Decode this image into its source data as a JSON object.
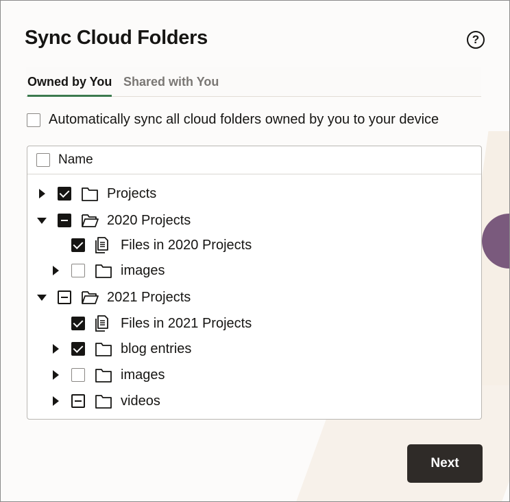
{
  "dialog": {
    "title": "Sync Cloud Folders",
    "help_icon": "question-circle-icon",
    "help_glyph": "?"
  },
  "tabs": [
    {
      "label": "Owned by You",
      "active": true
    },
    {
      "label": "Shared with You",
      "active": false
    }
  ],
  "auto_sync": {
    "label": "Automatically sync all cloud folders owned by you to your device",
    "checked": false
  },
  "tree": {
    "header": {
      "label": "Name",
      "checked": false
    },
    "rows": [
      {
        "label": "Projects",
        "level": 0,
        "expander": "collapsed",
        "state": "checked",
        "icon": "folder-icon"
      },
      {
        "label": "2020 Projects",
        "level": 0,
        "expander": "expanded",
        "state": "mixed-dark",
        "icon": "folder-open-icon"
      },
      {
        "label": "Files in 2020 Projects",
        "level": 1,
        "expander": "none",
        "state": "checked",
        "icon": "document-icon"
      },
      {
        "label": "images",
        "level": 1,
        "expander": "collapsed",
        "state": "unchecked",
        "icon": "folder-icon"
      },
      {
        "label": "2021 Projects",
        "level": 0,
        "expander": "expanded",
        "state": "mixed-light",
        "icon": "folder-open-icon"
      },
      {
        "label": "Files in 2021 Projects",
        "level": 1,
        "expander": "none",
        "state": "checked",
        "icon": "document-icon"
      },
      {
        "label": "blog entries",
        "level": 1,
        "expander": "collapsed",
        "state": "checked",
        "icon": "folder-icon"
      },
      {
        "label": "images",
        "level": 1,
        "expander": "collapsed",
        "state": "unchecked",
        "icon": "folder-icon"
      },
      {
        "label": "videos",
        "level": 1,
        "expander": "collapsed",
        "state": "mixed-light",
        "icon": "folder-icon"
      }
    ]
  },
  "footer": {
    "next_label": "Next"
  },
  "colors": {
    "accent_tab": "#3c7a4f",
    "button_bg": "#2f2b28"
  }
}
